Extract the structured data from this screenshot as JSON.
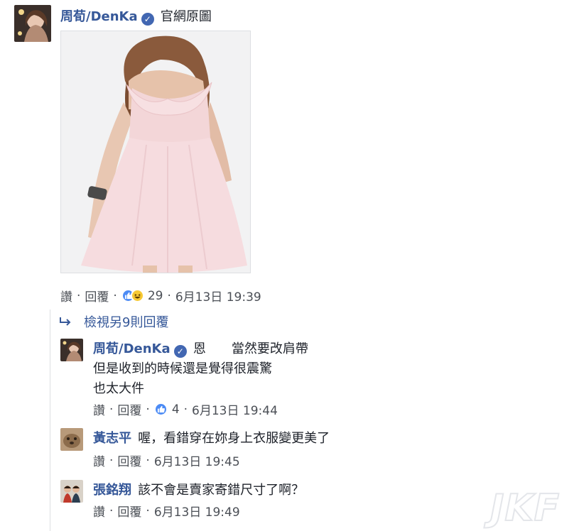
{
  "main_comment": {
    "author": "周荀/DenKa",
    "text": "官網原圖",
    "image_alt": "pink dress photo",
    "actions": {
      "like": "讚",
      "reply": "回覆",
      "reactions_count": "29",
      "timestamp": "6月13日 19:39"
    }
  },
  "view_more_replies": "檢視另9則回覆",
  "replies": [
    {
      "author": "周荀/DenKa",
      "lines": [
        "恩　　當然要改肩帶",
        "但是收到的時候還是覺得很震驚",
        "也太大件"
      ],
      "actions": {
        "like": "讚",
        "reply": "回覆",
        "reactions_count": "4",
        "timestamp": "6月13日 19:44"
      }
    },
    {
      "author": "黃志平",
      "text": "喔，看錯穿在妳身上衣服變更美了",
      "actions": {
        "like": "讚",
        "reply": "回覆",
        "timestamp": "6月13日 19:45"
      }
    },
    {
      "author": "張銘翔",
      "text": "該不會是賣家寄錯尺寸了啊？",
      "actions": {
        "like": "讚",
        "reply": "回覆",
        "timestamp": "6月13日 19:49"
      }
    }
  ],
  "separator": "·",
  "watermark": "JKF",
  "colors": {
    "name": "#365899",
    "like_blue": "#4c8bf5",
    "haha_yellow": "#f7c934",
    "verified": "#4267b2"
  }
}
